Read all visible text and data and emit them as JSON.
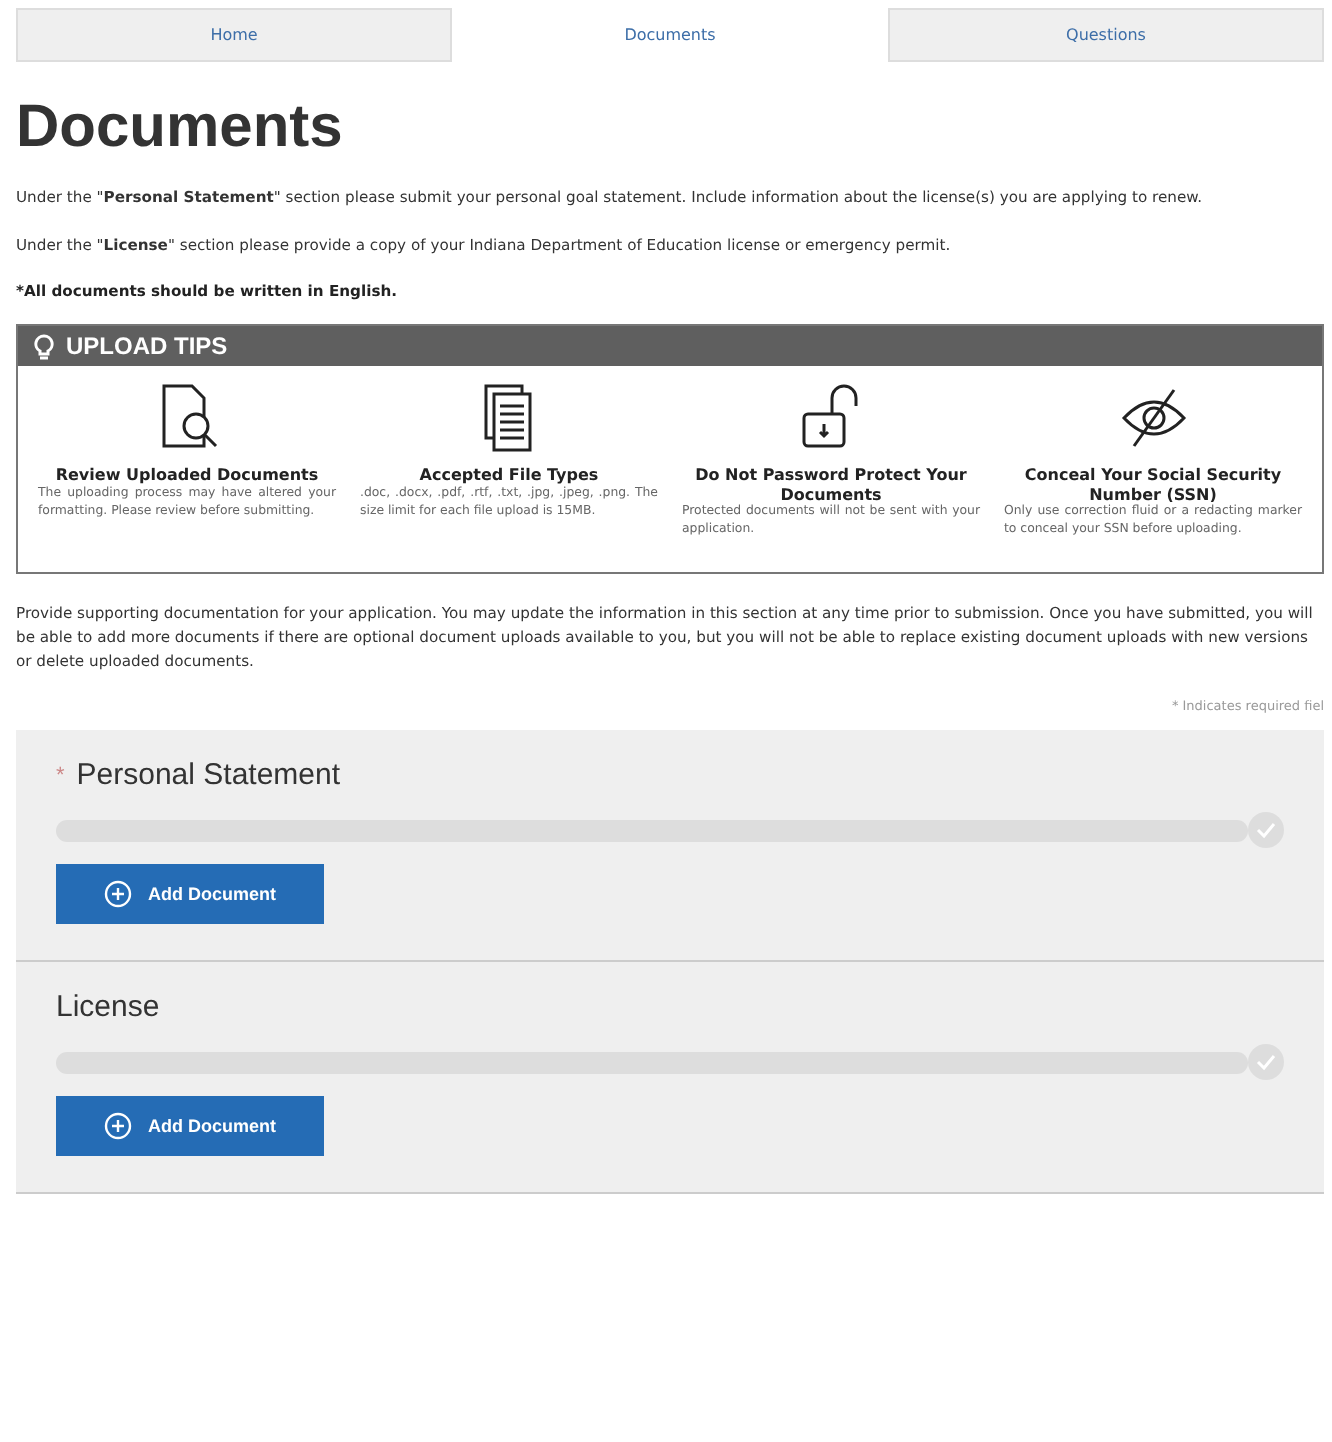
{
  "tabs": [
    {
      "label": "Home",
      "selected": false
    },
    {
      "label": "Documents",
      "selected": true
    },
    {
      "label": "Questions",
      "selected": false
    }
  ],
  "title": "Documents",
  "intro": [
    "Under the \"**Personal Statement**\" section please submit your personal goal statement. Include information about the license(s) you are applying to renew.",
    "Under the \"**License**\" section please provide a copy of your Indiana Department of Education license or emergency permit."
  ],
  "note": "*All documents should be written in English.",
  "tips": {
    "heading": "UPLOAD TIPS",
    "items": [
      {
        "kind": "review",
        "title": "Review Uploaded Documents",
        "text": "The uploading process may have altered your formatting. Please review before submitting."
      },
      {
        "kind": "files",
        "title": "Accepted File Types",
        "text": ".doc, .docx, .pdf, .rtf, .txt, .jpg, .jpeg, .png. The size limit for each file upload is 15MB."
      },
      {
        "kind": "lock",
        "title": "Do Not Password Protect Your Documents",
        "text": "Protected documents will not be sent with your application."
      },
      {
        "kind": "hidden",
        "title": "Conceal Your Social Security Number (SSN)",
        "text": "Only use correction fluid or a redacting marker to conceal your SSN before uploading."
      }
    ]
  },
  "description": "Provide supporting documentation for your application. You may update the information in this section at any time prior to submission. Once you have submitted, you will be able to add more documents if there are optional document uploads available to you, but you will not be able to replace existing document uploads with new versions or delete uploaded documents.",
  "required_note": "* Indicates required fiel",
  "required_mark": "*",
  "sections": [
    {
      "title": "Personal Statement",
      "required": true,
      "level": 0,
      "button": "Add Document"
    },
    {
      "title": "License",
      "required": false,
      "level": 0,
      "button": "Add Document"
    }
  ]
}
